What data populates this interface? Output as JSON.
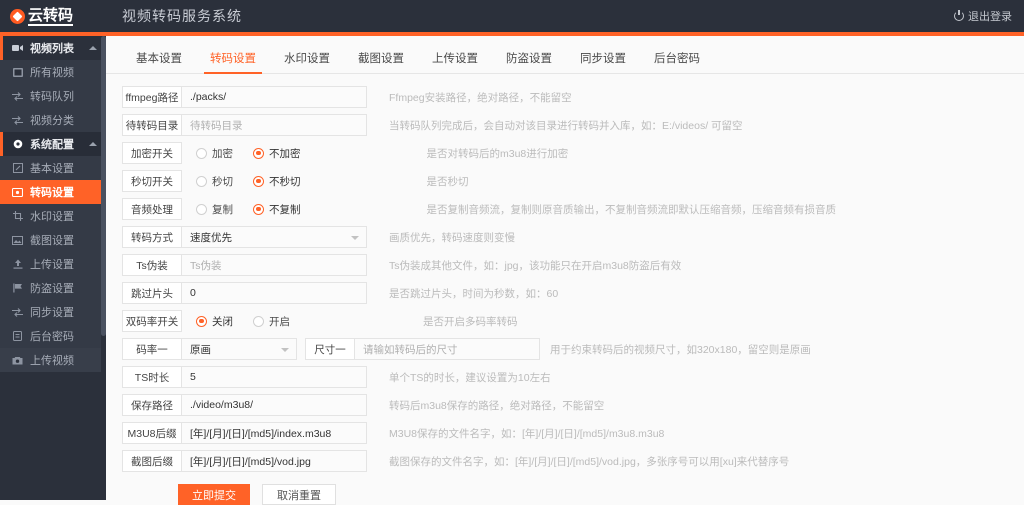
{
  "header": {
    "logo_text": "云转码",
    "title": "视频转码服务系统",
    "logout_label": "退出登录",
    "accent_color": "#ff6227",
    "bg_color": "#2b303b"
  },
  "sidebar": {
    "groups": [
      {
        "label": "视频列表",
        "icon": "video-camera-icon",
        "expanded": true,
        "items": [
          {
            "label": "所有视频",
            "icon": "film-icon",
            "selected": false
          },
          {
            "label": "转码队列",
            "icon": "exchange-icon",
            "selected": false
          },
          {
            "label": "视频分类",
            "icon": "exchange-icon",
            "selected": false
          }
        ]
      },
      {
        "label": "系统配置",
        "icon": "gear-icon",
        "expanded": true,
        "items": [
          {
            "label": "基本设置",
            "icon": "edit-icon",
            "selected": false
          },
          {
            "label": "转码设置",
            "icon": "transcode-icon",
            "selected": true
          },
          {
            "label": "水印设置",
            "icon": "crop-icon",
            "selected": false
          },
          {
            "label": "截图设置",
            "icon": "image-icon",
            "selected": false
          },
          {
            "label": "上传设置",
            "icon": "upload-icon",
            "selected": false
          },
          {
            "label": "防盗设置",
            "icon": "flag-icon",
            "selected": false
          },
          {
            "label": "同步设置",
            "icon": "exchange-icon",
            "selected": false
          },
          {
            "label": "后台密码",
            "icon": "lock-icon",
            "selected": false
          },
          {
            "label": "上传视频",
            "icon": "camera-icon",
            "selected": false
          }
        ]
      }
    ]
  },
  "tabs": [
    {
      "label": "基本设置",
      "active": false
    },
    {
      "label": "转码设置",
      "active": true
    },
    {
      "label": "水印设置",
      "active": false
    },
    {
      "label": "截图设置",
      "active": false
    },
    {
      "label": "上传设置",
      "active": false
    },
    {
      "label": "防盗设置",
      "active": false
    },
    {
      "label": "同步设置",
      "active": false
    },
    {
      "label": "后台密码",
      "active": false
    }
  ],
  "form": {
    "ffmpeg_path": {
      "label": "ffmpeg路径",
      "value": "./packs/",
      "placeholder": "ffmpeg路径",
      "hint": "Ffmpeg安装路径，绝对路径，不能留空"
    },
    "pending_dir": {
      "label": "待转码目录",
      "value": "",
      "placeholder": "待转码目录",
      "hint": "当转码队列完成后，会自动对该目录进行转码并入库，如：E:/videos/ 可留空"
    },
    "encrypt": {
      "label": "加密开关",
      "options": [
        {
          "label": "加密",
          "selected": false
        },
        {
          "label": "不加密",
          "selected": true
        }
      ],
      "hint": "是否对转码后的m3u8进行加密"
    },
    "fastcut": {
      "label": "秒切开关",
      "options": [
        {
          "label": "秒切",
          "selected": false
        },
        {
          "label": "不秒切",
          "selected": true
        }
      ],
      "hint": "是否秒切"
    },
    "audio": {
      "label": "音频处理",
      "options": [
        {
          "label": "复制",
          "selected": false
        },
        {
          "label": "不复制",
          "selected": true
        }
      ],
      "hint": "是否复制音频流，复制则原音质输出，不复制音频流即默认压缩音频，压缩音频有损音质"
    },
    "mode": {
      "label": "转码方式",
      "value": "速度优先",
      "options": [
        "速度优先",
        "画质优先"
      ],
      "hint": "画质优先，转码速度则变慢"
    },
    "ts_disguise": {
      "label": "Ts伪装",
      "value": "",
      "placeholder": "Ts伪装",
      "hint": "Ts伪装成其他文件，如：jpg，该功能只在开启m3u8防盗后有效"
    },
    "skip_intro": {
      "label": "跳过片头",
      "value": "0",
      "placeholder": "跳过片头",
      "hint": "是否跳过片头，时间为秒数，如：60"
    },
    "dual_rate": {
      "label": "双码率开关",
      "options": [
        {
          "label": "关闭",
          "selected": true
        },
        {
          "label": "开启",
          "selected": false
        }
      ],
      "hint": "是否开启多码率转码"
    },
    "rate_one": {
      "label": "码率一",
      "value": "原画",
      "options": [
        "原画"
      ],
      "size_label": "尺寸一",
      "size_value": "",
      "size_placeholder": "请输如转码后的尺寸",
      "hint": "用于约束转码后的视频尺寸，如320x180，留空则是原画"
    },
    "ts_duration": {
      "label": "TS时长",
      "value": "5",
      "placeholder": "TS时长",
      "hint": "单个TS的时长，建议设置为10左右"
    },
    "save_path": {
      "label": "保存路径",
      "value": "./video/m3u8/",
      "placeholder": "保存路径",
      "hint": "转码后m3u8保存的路径，绝对路径，不能留空"
    },
    "m3u8_suffix": {
      "label": "M3U8后缀",
      "value": "[年]/[月]/[日]/[md5]/index.m3u8",
      "placeholder": "M3U8后缀",
      "hint": "M3U8保存的文件名字，如：[年]/[月]/[日]/[md5]/m3u8.m3u8"
    },
    "snapshot_suffix": {
      "label": "截图后缀",
      "value": "[年]/[月]/[日]/[md5]/vod.jpg",
      "placeholder": "截图后缀",
      "hint": "截图保存的文件名字，如：[年]/[月]/[日]/[md5]/vod.jpg，多张序号可以用[xu]来代替序号"
    },
    "submit_label": "立即提交",
    "reset_label": "取消重置"
  }
}
